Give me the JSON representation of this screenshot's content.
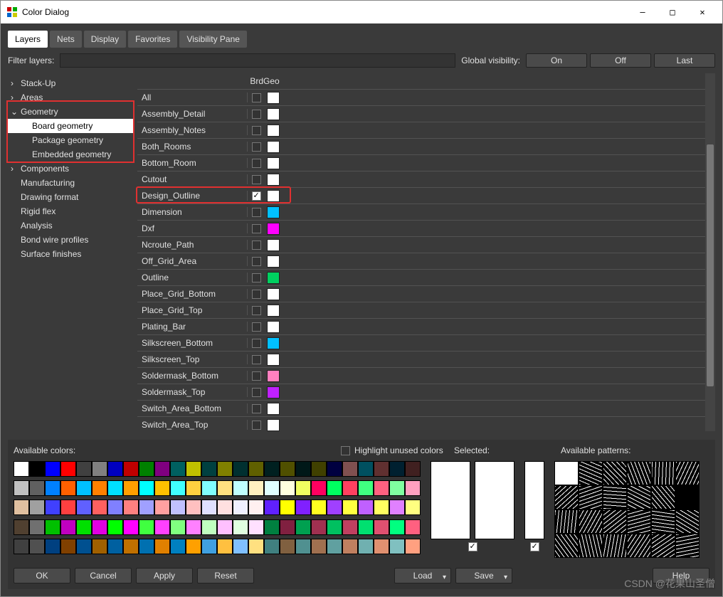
{
  "window": {
    "title": "Color Dialog",
    "min": "—",
    "max": "□",
    "close": "✕"
  },
  "tabs": [
    "Layers",
    "Nets",
    "Display",
    "Favorites",
    "Visibility Pane"
  ],
  "active_tab": 0,
  "filter": {
    "label": "Filter layers:",
    "value": "",
    "placeholder": ""
  },
  "global_visibility": {
    "label": "Global visibility:",
    "buttons": [
      "On",
      "Off",
      "Last"
    ]
  },
  "tree": {
    "items": [
      {
        "label": "Stack-Up",
        "level": 0,
        "arrow": "›"
      },
      {
        "label": "Areas",
        "level": 0,
        "arrow": "›"
      },
      {
        "label": "Geometry",
        "level": 0,
        "arrow": "⌄",
        "expanded": true
      },
      {
        "label": "Board geometry",
        "level": 1,
        "selected": true
      },
      {
        "label": "Package geometry",
        "level": 1
      },
      {
        "label": "Embedded geometry",
        "level": 1
      },
      {
        "label": "Components",
        "level": 0,
        "arrow": "›"
      },
      {
        "label": "Manufacturing",
        "level": 0
      },
      {
        "label": "Drawing format",
        "level": 0
      },
      {
        "label": "Rigid flex",
        "level": 0
      },
      {
        "label": "Analysis",
        "level": 0
      },
      {
        "label": "Bond wire profiles",
        "level": 0
      },
      {
        "label": "Surface finishes",
        "level": 0
      }
    ]
  },
  "grid": {
    "column_header": "BrdGeo",
    "rows": [
      {
        "name": "All",
        "checked": false,
        "color": "#ffffff"
      },
      {
        "name": "Assembly_Detail",
        "checked": false,
        "color": "#ffffff"
      },
      {
        "name": "Assembly_Notes",
        "checked": false,
        "color": "#ffffff"
      },
      {
        "name": "Both_Rooms",
        "checked": false,
        "color": "#ffffff"
      },
      {
        "name": "Bottom_Room",
        "checked": false,
        "color": "#ffffff"
      },
      {
        "name": "Cutout",
        "checked": false,
        "color": "#ffffff"
      },
      {
        "name": "Design_Outline",
        "checked": true,
        "color": "#ffffff",
        "highlight": true
      },
      {
        "name": "Dimension",
        "checked": false,
        "color": "#00c0ff"
      },
      {
        "name": "Dxf",
        "checked": false,
        "color": "#ff00ff"
      },
      {
        "name": "Ncroute_Path",
        "checked": false,
        "color": "#ffffff"
      },
      {
        "name": "Off_Grid_Area",
        "checked": false,
        "color": "#ffffff"
      },
      {
        "name": "Outline",
        "checked": false,
        "color": "#00d060"
      },
      {
        "name": "Place_Grid_Bottom",
        "checked": false,
        "color": "#ffffff"
      },
      {
        "name": "Place_Grid_Top",
        "checked": false,
        "color": "#ffffff"
      },
      {
        "name": "Plating_Bar",
        "checked": false,
        "color": "#ffffff"
      },
      {
        "name": "Silkscreen_Bottom",
        "checked": false,
        "color": "#00c0ff"
      },
      {
        "name": "Silkscreen_Top",
        "checked": false,
        "color": "#ffffff"
      },
      {
        "name": "Soldermask_Bottom",
        "checked": false,
        "color": "#ff80c0"
      },
      {
        "name": "Soldermask_Top",
        "checked": false,
        "color": "#c020ff"
      },
      {
        "name": "Switch_Area_Bottom",
        "checked": false,
        "color": "#ffffff"
      },
      {
        "name": "Switch_Area_Top",
        "checked": false,
        "color": "#ffffff"
      }
    ]
  },
  "available_colors_label": "Available colors:",
  "highlight_unused_label": "Highlight unused colors",
  "selected_label": "Selected:",
  "available_patterns_label": "Available patterns:",
  "palette": [
    "#ffffff",
    "#000000",
    "#0000ff",
    "#ff0000",
    "#404040",
    "#808080",
    "#0000c0",
    "#c00000",
    "#008000",
    "#800080",
    "#006060",
    "#c0c000",
    "#004040",
    "#808000",
    "#003030",
    "#606000",
    "#002020",
    "#505000",
    "#001818",
    "#404000",
    "#000040",
    "#805050",
    "#005060",
    "#603030",
    "#002030",
    "#402020",
    "#c0c0c0",
    "#606060",
    "#0080ff",
    "#ff6000",
    "#00c0ff",
    "#ff8000",
    "#00e0ff",
    "#ffa000",
    "#00ffff",
    "#ffc000",
    "#40ffff",
    "#ffd040",
    "#80ffff",
    "#ffe080",
    "#c0ffff",
    "#fff0c0",
    "#dfffff",
    "#ffffdf",
    "#f0ff60",
    "#ff0060",
    "#00ff60",
    "#ff4060",
    "#40ff80",
    "#ff6080",
    "#80ffa0",
    "#ffa0c0",
    "#e0c0a0",
    "#a0a0a0",
    "#4040ff",
    "#ff4040",
    "#6060ff",
    "#ff6060",
    "#8080ff",
    "#ff8080",
    "#a0a0ff",
    "#ffa0a0",
    "#c0c0ff",
    "#ffc0c0",
    "#e0e0ff",
    "#ffe0e0",
    "#f0f0ff",
    "#fff0f0",
    "#6020ff",
    "#ffff00",
    "#8020ff",
    "#ffff20",
    "#a040ff",
    "#ffff40",
    "#c060ff",
    "#ffff60",
    "#e080ff",
    "#ffff80",
    "#504030",
    "#707070",
    "#00c000",
    "#c000c0",
    "#00e000",
    "#e000e0",
    "#00ff00",
    "#ff00ff",
    "#40ff40",
    "#ff40ff",
    "#80ff80",
    "#ff80ff",
    "#c0ffc0",
    "#ffc0ff",
    "#e0ffe0",
    "#ffe0ff",
    "#008040",
    "#802040",
    "#00a050",
    "#a03050",
    "#00c060",
    "#c04060",
    "#00e070",
    "#e05070",
    "#00ff80",
    "#ff6080",
    "#404040",
    "#505050",
    "#004080",
    "#804000",
    "#005090",
    "#a06000",
    "#0060a0",
    "#c07000",
    "#0070b0",
    "#e08000",
    "#0080c0",
    "#ffa000",
    "#40a0e0",
    "#ffc040",
    "#80c0ff",
    "#ffe080",
    "#408080",
    "#806040",
    "#509090",
    "#a07050",
    "#60a0a0",
    "#c08060",
    "#70b0b0",
    "#e09070",
    "#80c0c0",
    "#ffa080"
  ],
  "footer": {
    "ok": "OK",
    "cancel": "Cancel",
    "apply": "Apply",
    "reset": "Reset",
    "load": "Load",
    "save": "Save",
    "help": "Help"
  },
  "watermark": "CSDN @花果山圣僧"
}
